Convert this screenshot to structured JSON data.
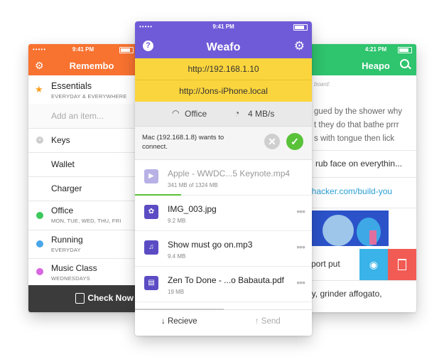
{
  "colors": {
    "remembo": "#f87230",
    "weafo": "#6f5bd8",
    "url_bar": "#fbd53d",
    "heapo": "#2fc46e",
    "accept": "#59c239",
    "delete": "#f25b54",
    "preview": "#3ab3e8"
  },
  "remembo": {
    "time": "9:41 PM",
    "title": "Remembo",
    "items": [
      {
        "label": "Essentials",
        "sub": "EVERYDAY & EVERYWHERE",
        "icon": "star-icon"
      },
      {
        "label": "Add an item...",
        "sub": "",
        "icon": ""
      },
      {
        "label": "Keys",
        "sub": "",
        "icon": "remove-icon"
      },
      {
        "label": "Wallet",
        "sub": "",
        "icon": ""
      },
      {
        "label": "Charger",
        "sub": "",
        "icon": ""
      },
      {
        "label": "Office",
        "sub": "MON, TUE, WED, THU, FRI",
        "icon": "dot-icon",
        "color": "#3cc85b"
      },
      {
        "label": "Running",
        "sub": "EVERYDAY",
        "icon": "dot-icon",
        "color": "#4aa6e8"
      },
      {
        "label": "Music Class",
        "sub": "WEDNESDAYS",
        "icon": "dot-icon",
        "color": "#d866e0"
      }
    ],
    "check_now": "Check Now"
  },
  "heapo": {
    "time": "4:21 PM",
    "title": "Heapo",
    "clipboard": "board:",
    "text": [
      "gued by the shower why",
      "t they do that bathe prrr",
      "s with tongue then lick"
    ],
    "item2": "rub face on everythin...",
    "link": "ehacker.com/build-you",
    "item4": "port put",
    "item5": "ny, grinder affogato,"
  },
  "weafo": {
    "time": "9:41 PM",
    "title": "Weafo",
    "urls": [
      "http://192.168.1.10",
      "http://Jons-iPhone.local"
    ],
    "network": "Office",
    "speed": "4 MB/s",
    "request": "Mac (192.168.1.8) wants to connect.",
    "files": [
      {
        "name": "Apple - WWDC...5 Keynote.mp4",
        "size": "341 MB of 1324 MB",
        "icon": "play-icon",
        "progress": 0.26
      },
      {
        "name": "IMG_003.jpg",
        "size": "9.2 MB",
        "icon": "image-icon"
      },
      {
        "name": "Show must go on.mp3",
        "size": "9.4 MB",
        "icon": "music-icon"
      },
      {
        "name": "Zen To Done - ...o Babauta.pdf",
        "size": "19 MB",
        "icon": "document-icon"
      }
    ],
    "receive": "↓ Recieve",
    "send": "↑ Send"
  }
}
